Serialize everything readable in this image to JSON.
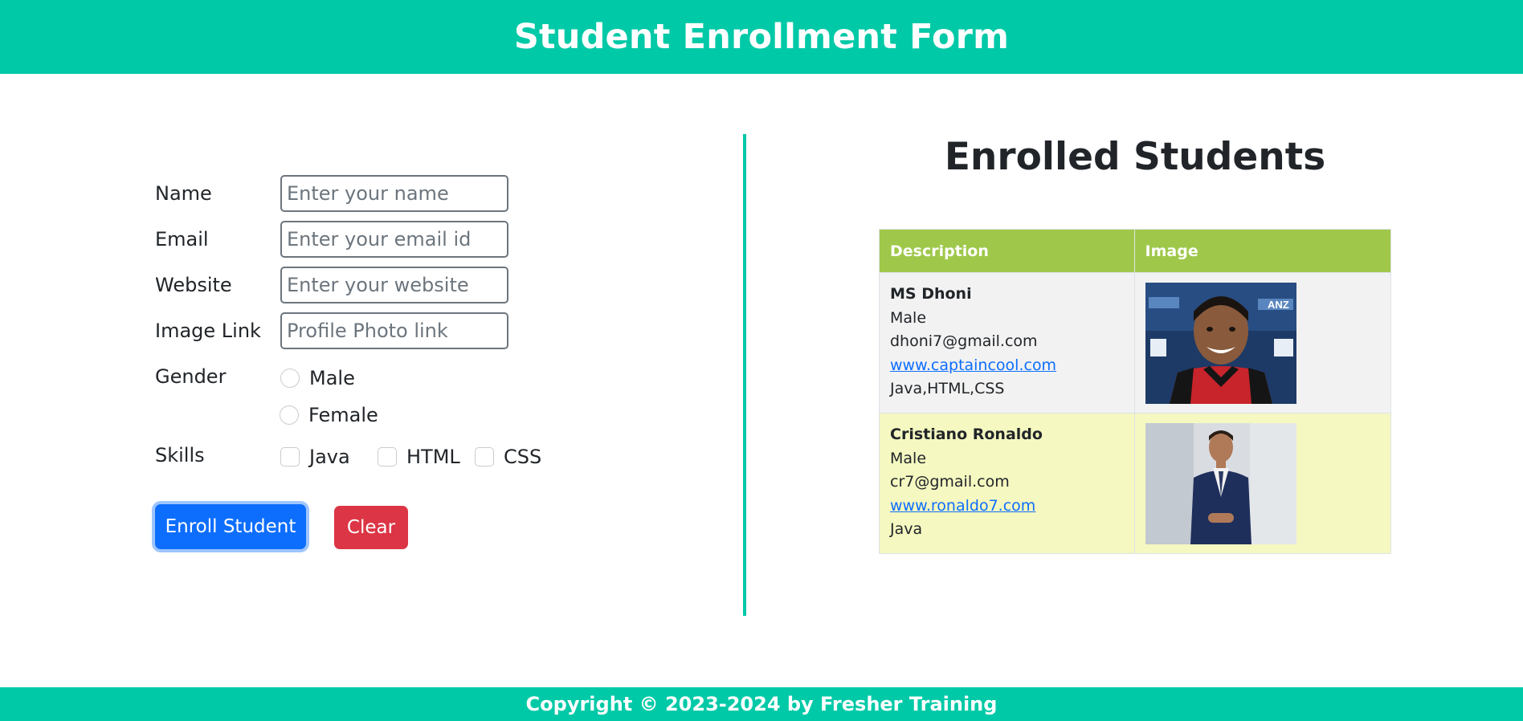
{
  "header": {
    "title": "Student Enrollment Form"
  },
  "form": {
    "name": {
      "label": "Name",
      "placeholder": "Enter your name"
    },
    "email": {
      "label": "Email",
      "placeholder": "Enter your email id"
    },
    "website": {
      "label": "Website",
      "placeholder": "Enter your website"
    },
    "image": {
      "label": "Image Link",
      "placeholder": "Profile Photo link"
    },
    "gender": {
      "label": "Gender",
      "options": [
        "Male",
        "Female"
      ]
    },
    "skills": {
      "label": "Skills",
      "options": [
        "Java",
        "HTML",
        "CSS"
      ]
    },
    "enroll_label": "Enroll Student",
    "clear_label": "Clear"
  },
  "enrolled": {
    "title": "Enrolled Students",
    "columns": [
      "Description",
      "Image"
    ],
    "students": [
      {
        "name": "MS Dhoni",
        "gender": "Male",
        "email": "dhoni7@gmail.com",
        "website": "www.captaincool.com",
        "skills": "Java,HTML,CSS",
        "image_icon": "profile-photo-dhoni"
      },
      {
        "name": "Cristiano Ronaldo",
        "gender": "Male",
        "email": "cr7@gmail.com",
        "website": "www.ronaldo7.com",
        "skills": "Java",
        "image_icon": "profile-photo-ronaldo"
      }
    ]
  },
  "footer": {
    "text": "Copyright © 2023-2024 by Fresher Training"
  },
  "colors": {
    "header": "#00c9a7",
    "table_header": "#9fc84a",
    "row1": "#f2f2f2",
    "row2": "#f5f8c0",
    "primary_button": "#0d6efd",
    "danger_button": "#dc3545"
  }
}
